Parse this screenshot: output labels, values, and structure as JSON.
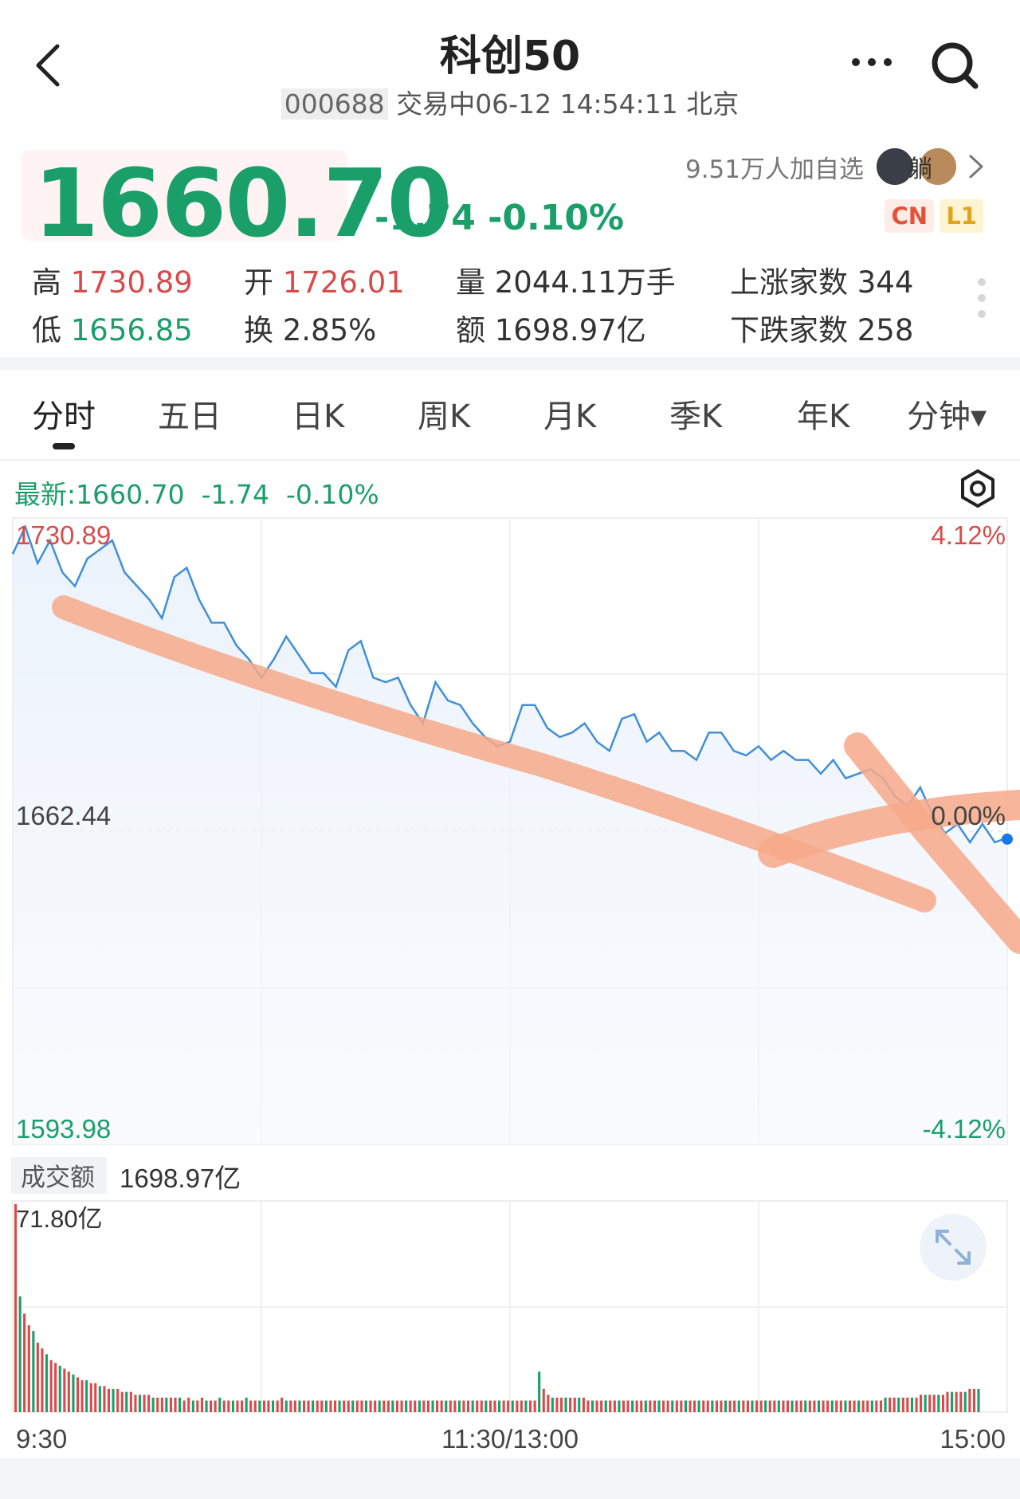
{
  "header": {
    "title": "科创50",
    "code": "000688",
    "status_time": "交易中06-12 14:54:11 北京",
    "back_icon": "chevron-left-icon",
    "more_icon": "more-horizontal-icon",
    "search_icon": "search-icon"
  },
  "quote": {
    "price": "1660.70",
    "change": "-1.74",
    "change_pct": "-0.10%",
    "followers": "9.51万人加自选",
    "avatar_text": "躺",
    "badge_cn": "CN",
    "badge_l1": "L1"
  },
  "stats": {
    "high_label": "高",
    "high_value": "1730.89",
    "low_label": "低",
    "low_value": "1656.85",
    "open_label": "开",
    "open_value": "1726.01",
    "turnover_label": "换",
    "turnover_value": "2.85%",
    "volume_label": "量",
    "volume_value": "2044.11万手",
    "amount_label": "额",
    "amount_value": "1698.97亿",
    "up_label": "上涨家数",
    "up_value": "344",
    "down_label": "下跌家数",
    "down_value": "258"
  },
  "tabs": [
    {
      "label": "分时",
      "active": true
    },
    {
      "label": "五日"
    },
    {
      "label": "日K"
    },
    {
      "label": "周K"
    },
    {
      "label": "月K"
    },
    {
      "label": "季K"
    },
    {
      "label": "年K"
    },
    {
      "label": "分钟▾"
    }
  ],
  "chart_header": {
    "latest_label": "最新:1660.70",
    "latest_change": "-1.74",
    "latest_pct": "-0.10%",
    "settings_icon": "gear-icon"
  },
  "colors": {
    "up": "#d94b4b",
    "down": "#1a9e6a",
    "line": "#3f8fd8",
    "annotation": "#f6a98a"
  },
  "chart_data": [
    {
      "type": "line",
      "title": "",
      "xlabel": "",
      "ylabel": "",
      "x_ticks": [
        "9:30",
        "11:30/13:00",
        "15:00"
      ],
      "y_left_ticks": [
        "1730.89",
        "1662.44",
        "1593.98"
      ],
      "y_right_ticks": [
        "4.12%",
        "0.00%",
        "-4.12%"
      ],
      "ylim": [
        1593.98,
        1730.89
      ],
      "prev_close": 1662.44,
      "last_price": 1660.7,
      "grid": true,
      "series": [
        {
          "x": [
            0,
            3,
            6,
            9,
            12,
            15,
            18,
            21,
            24,
            27,
            30,
            33,
            36,
            39,
            42,
            45,
            48,
            51,
            54,
            57,
            60,
            63,
            66,
            69,
            72,
            75,
            78,
            81,
            84,
            87,
            90,
            93,
            96,
            99,
            102,
            105,
            108,
            111,
            114,
            117,
            120,
            123,
            126,
            129,
            132,
            135,
            138,
            141,
            144,
            147,
            150,
            153,
            156,
            159,
            162,
            165,
            168,
            171,
            174,
            177,
            180,
            183,
            186,
            189,
            192,
            195,
            198,
            201,
            204,
            207,
            210,
            213,
            216,
            219,
            222,
            225,
            228,
            231,
            234,
            237,
            240
          ],
          "values": [
            1723,
            1729,
            1721,
            1726,
            1719,
            1716,
            1722,
            1724,
            1726,
            1719,
            1716,
            1713,
            1709,
            1718,
            1720,
            1713,
            1708,
            1708,
            1703,
            1700,
            1696,
            1700,
            1705,
            1701,
            1697,
            1697,
            1694,
            1702,
            1704,
            1696,
            1695,
            1696,
            1690,
            1686,
            1695,
            1691,
            1690,
            1686,
            1683,
            1681,
            1682,
            1690,
            1690,
            1685,
            1683,
            1684,
            1686,
            1682,
            1680,
            1687,
            1688,
            1682,
            1684,
            1680,
            1680,
            1678,
            1684,
            1684,
            1680,
            1679,
            1681,
            1678,
            1680,
            1678,
            1678,
            1675,
            1678,
            1674,
            1675,
            1676,
            1674,
            1670,
            1668,
            1672,
            1666,
            1662,
            1664,
            1660,
            1664,
            1660,
            1661
          ]
        }
      ],
      "annotations": [
        "hand-drawn downward arrow",
        "hand-drawn reversal arrow"
      ]
    },
    {
      "type": "bar",
      "title": "成交额",
      "total_label": "1698.97亿",
      "max_label": "71.80亿",
      "ylim": [
        0,
        71.8
      ],
      "values": [
        71.8,
        40,
        34,
        30,
        28,
        24,
        22,
        20,
        18,
        17,
        16,
        15,
        14,
        13,
        12,
        11,
        11,
        10,
        10,
        9,
        9,
        8,
        8,
        8,
        7,
        7,
        7,
        6,
        6,
        6,
        6,
        5,
        5,
        5,
        5,
        5,
        5,
        5,
        4,
        5,
        4,
        4,
        5,
        4,
        4,
        4,
        5,
        4,
        4,
        4,
        4,
        4,
        5,
        4,
        4,
        4,
        4,
        4,
        4,
        4,
        5,
        4,
        4,
        4,
        4,
        4,
        4,
        4,
        4,
        4,
        4,
        4,
        4,
        4,
        4,
        4,
        4,
        4,
        4,
        4,
        4,
        4,
        4,
        4,
        4,
        4,
        4,
        4,
        4,
        4,
        4,
        4,
        4,
        4,
        4,
        4,
        4,
        4,
        4,
        4,
        4,
        4,
        4,
        4,
        4,
        4,
        4,
        4,
        4,
        4,
        4,
        4,
        4,
        4,
        4,
        4,
        4,
        4,
        14,
        8,
        6,
        5,
        5,
        5,
        5,
        5,
        5,
        5,
        5,
        4,
        4,
        4,
        4,
        4,
        4,
        4,
        4,
        4,
        4,
        4,
        4,
        4,
        4,
        4,
        4,
        4,
        4,
        4,
        4,
        4,
        4,
        4,
        4,
        4,
        4,
        4,
        4,
        4,
        4,
        4,
        4,
        4,
        4,
        4,
        4,
        4,
        4,
        4,
        4,
        4,
        4,
        4,
        4,
        4,
        4,
        4,
        4,
        4,
        4,
        4,
        4,
        4,
        4,
        4,
        4,
        4,
        4,
        4,
        4,
        4,
        4,
        4,
        4,
        4,
        4,
        4,
        5,
        5,
        5,
        5,
        5,
        5,
        5,
        5,
        6,
        6,
        6,
        6,
        6,
        6,
        7,
        7,
        7,
        7,
        7,
        8,
        8,
        8
      ]
    }
  ]
}
